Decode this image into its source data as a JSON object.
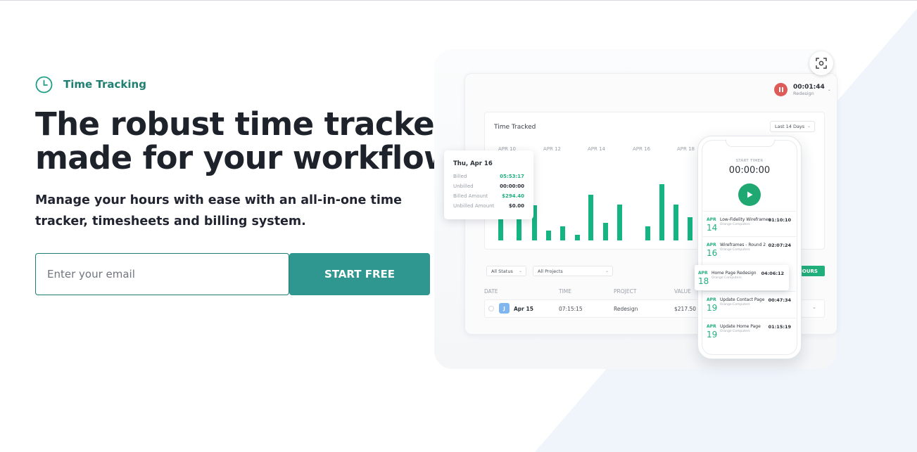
{
  "hero": {
    "eyebrow": "Time Tracking",
    "headline_line1": "The robust time tracker",
    "headline_line2": "made for your workflow.",
    "subhead": "Manage your hours with ease with an all-in-one time tracker, timesheets and billing system.",
    "email_placeholder": "Enter your email",
    "cta_label": "START FREE"
  },
  "mock": {
    "running_timer": {
      "time": "00:01:44",
      "project": "Redesign"
    },
    "chart": {
      "title": "Time Tracked",
      "range": "Last 14 Days",
      "dates": [
        "APR 10",
        "APR 12",
        "APR 14",
        "APR 16",
        "APR 18"
      ]
    },
    "tooltip": {
      "date": "Thu, Apr 16",
      "rows": [
        {
          "key": "Billed",
          "value": "05:53:17"
        },
        {
          "key": "Unbilled",
          "value": "00:00:00"
        },
        {
          "key": "Billed Amount",
          "value": "$294.40"
        },
        {
          "key": "Unbilled Amount",
          "value": "$0.00"
        }
      ]
    },
    "filters": {
      "status": "All Status",
      "projects": "All Projects",
      "hours_button": "HOURS"
    },
    "table": {
      "headers": [
        "DATE",
        "TIME",
        "PROJECT",
        "VALUE"
      ],
      "row": {
        "avatar": "J",
        "date": "Apr 15",
        "time": "07:15:15",
        "project": "Redesign",
        "value": "$217.50"
      }
    },
    "phone": {
      "label": "START TIMER",
      "time": "00:00:00",
      "entries": [
        {
          "month": "APR",
          "day": "14",
          "name": "Low-Fidelity Wireframes",
          "client": "Orange Computers",
          "duration": "01:10:10"
        },
        {
          "month": "APR",
          "day": "16",
          "name": "Wireframes - Round 2",
          "client": "Orange Computers",
          "duration": "02:07:24"
        },
        {
          "month": "APR",
          "day": "18",
          "name": "Home Page Redesign",
          "client": "Orange Computers",
          "duration": "04:06:12"
        },
        {
          "month": "APR",
          "day": "19",
          "name": "Update Contact Page",
          "client": "Orange Computers",
          "duration": "00:47:34"
        },
        {
          "month": "APR",
          "day": "19",
          "name": "Update Home Page",
          "client": "Orange Computers",
          "duration": "01:15:19"
        }
      ]
    }
  },
  "colors": {
    "brand_teal": "#2f9690",
    "accent_green": "#20b07e",
    "stop_red": "#df5b58"
  }
}
